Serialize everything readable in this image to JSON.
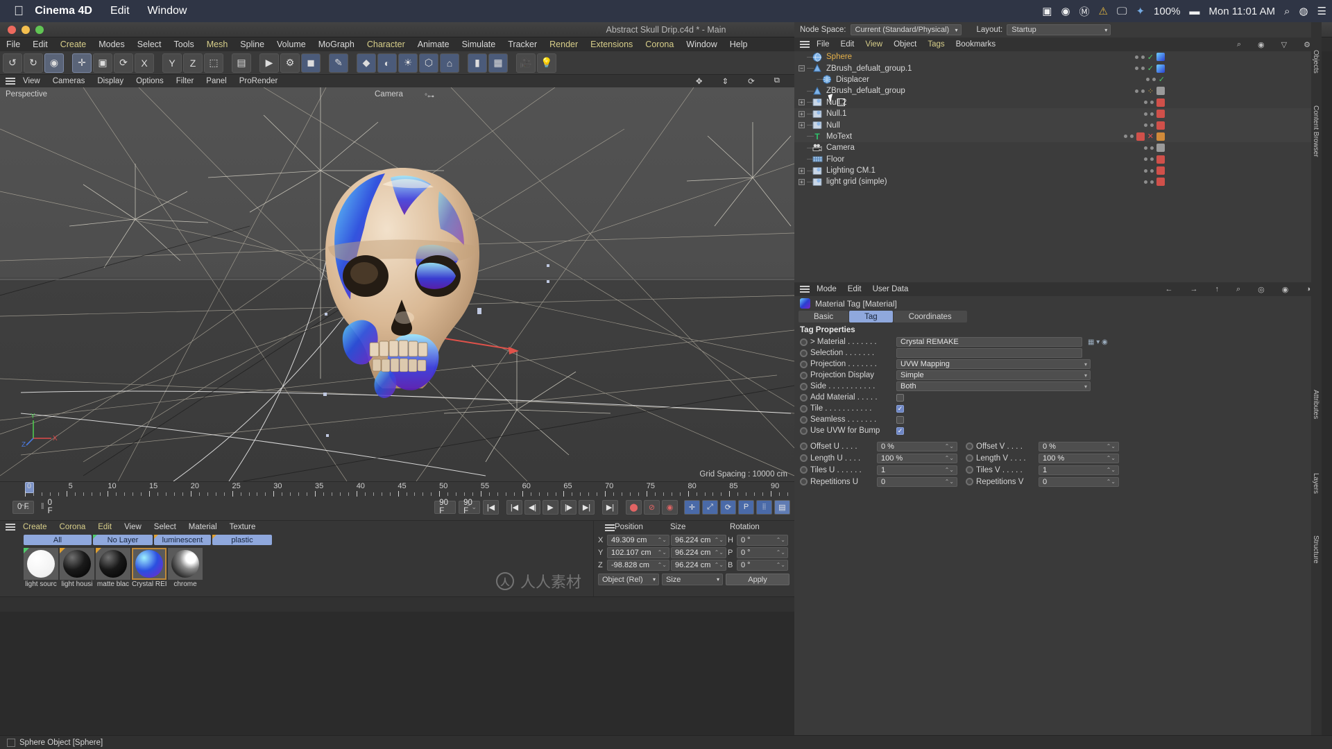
{
  "mac_menu": {
    "apple": "apple-logo",
    "items": [
      "Cinema 4D",
      "Edit",
      "Window"
    ],
    "status": {
      "battery": "100%",
      "time": "Mon 11:01 AM",
      "icons": [
        "screen-record-icon",
        "control-icon",
        "music-icon",
        "warning-icon",
        "display-icon",
        "bluetooth-icon",
        "battery-icon",
        "search-icon",
        "siri-icon",
        "control-center-icon"
      ]
    }
  },
  "window": {
    "title": "Abstract Skull Drip.c4d * - Main"
  },
  "app_menu": {
    "items": [
      {
        "label": "File",
        "accent": false
      },
      {
        "label": "Edit",
        "accent": false
      },
      {
        "label": "Create",
        "accent": true
      },
      {
        "label": "Modes",
        "accent": false
      },
      {
        "label": "Select",
        "accent": false
      },
      {
        "label": "Tools",
        "accent": false
      },
      {
        "label": "Mesh",
        "accent": true
      },
      {
        "label": "Spline",
        "accent": false
      },
      {
        "label": "Volume",
        "accent": false
      },
      {
        "label": "MoGraph",
        "accent": false
      },
      {
        "label": "Character",
        "accent": true
      },
      {
        "label": "Animate",
        "accent": false
      },
      {
        "label": "Simulate",
        "accent": false
      },
      {
        "label": "Tracker",
        "accent": false
      },
      {
        "label": "Render",
        "accent": true
      },
      {
        "label": "Extensions",
        "accent": true
      },
      {
        "label": "Corona",
        "accent": true
      },
      {
        "label": "Window",
        "accent": false
      },
      {
        "label": "Help",
        "accent": false
      }
    ]
  },
  "toolbar": {
    "buttons": [
      {
        "name": "undo-button",
        "glyph": "↺"
      },
      {
        "name": "redo-button",
        "glyph": "↻"
      },
      {
        "name": "live-selection-tool",
        "glyph": "◉",
        "state": "selected"
      },
      {
        "name": "move-tool",
        "glyph": "✛",
        "state": "selected"
      },
      {
        "name": "scale-tool",
        "glyph": "▣"
      },
      {
        "name": "rotate-tool",
        "glyph": "⟳"
      },
      {
        "name": "axis-lock-x",
        "glyph": "X"
      },
      {
        "name": "axis-lock-y",
        "glyph": "Y"
      },
      {
        "name": "axis-lock-z",
        "glyph": "Z"
      },
      {
        "name": "world-object-toggle",
        "glyph": "⬚"
      },
      {
        "name": "render-view-button",
        "glyph": "▤"
      },
      {
        "name": "render-region-button",
        "glyph": "▶"
      },
      {
        "name": "render-settings-button",
        "glyph": "⚙"
      },
      {
        "name": "cube-primitive-button",
        "glyph": "◼"
      },
      {
        "name": "spline-pen-button",
        "glyph": "✎"
      },
      {
        "name": "generator-button",
        "glyph": "◆"
      },
      {
        "name": "bend-deformer-button",
        "glyph": "◐"
      },
      {
        "name": "environment-button",
        "glyph": "☀"
      },
      {
        "name": "mograph-button",
        "glyph": "⬡"
      },
      {
        "name": "camera-button",
        "glyph": "⌂"
      },
      {
        "name": "light-button",
        "glyph": "▮"
      },
      {
        "name": "corona-render-button",
        "glyph": "▦"
      },
      {
        "name": "corona-camera-button",
        "glyph": "🎥"
      },
      {
        "name": "corona-light-button",
        "glyph": "💡"
      }
    ]
  },
  "viewport": {
    "menu": [
      "View",
      "Cameras",
      "Display",
      "Options",
      "Filter",
      "Panel",
      "ProRender"
    ],
    "perspective_label": "Perspective",
    "camera_label": "Camera",
    "grid_label": "Grid Spacing : 10000 cm",
    "axis_labels": {
      "x": "X",
      "y": "Y",
      "z": "Z"
    },
    "corner_icons": [
      "pan-icon",
      "dolly-icon",
      "rotate-icon",
      "maximize-icon"
    ]
  },
  "timeline": {
    "ticks": [
      0,
      5,
      10,
      15,
      20,
      25,
      30,
      35,
      40,
      45,
      50,
      55,
      60,
      65,
      70,
      75,
      80,
      85,
      90
    ],
    "current_frame": "0 F",
    "current_frame_2": "0 F",
    "start_frame": "0 F",
    "preview_min": "0 F",
    "preview_max": "90 F",
    "end_frame": "90 F",
    "right_frame": "0 F",
    "transport": [
      {
        "name": "goto-start-button",
        "glyph": "|◀"
      },
      {
        "name": "go-to-start-button",
        "glyph": "|◀"
      },
      {
        "name": "step-back-button",
        "glyph": "◀|"
      },
      {
        "name": "play-button",
        "glyph": "▶"
      },
      {
        "name": "step-forward-button",
        "glyph": "|▶"
      },
      {
        "name": "goto-end-button",
        "glyph": "▶|"
      },
      {
        "name": "next-key-button",
        "glyph": "▶|"
      }
    ],
    "record_buttons": [
      {
        "name": "record-active-objects-button",
        "glyph": "⬤"
      },
      {
        "name": "autokeying-button",
        "glyph": "⊘"
      },
      {
        "name": "keyframe-selection-button",
        "glyph": "◉"
      },
      {
        "name": "position-key-button",
        "glyph": "✛"
      },
      {
        "name": "scale-key-button",
        "glyph": "⤢"
      },
      {
        "name": "rotation-key-button",
        "glyph": "⟳"
      },
      {
        "name": "param-key-button",
        "glyph": "P"
      },
      {
        "name": "pla-key-button",
        "glyph": "⦙⦙"
      },
      {
        "name": "level-of-detail-button",
        "glyph": "▤"
      }
    ]
  },
  "material_manager": {
    "menu": [
      "Create",
      "Corona",
      "Edit",
      "View",
      "Select",
      "Material",
      "Texture"
    ],
    "layers": [
      "All",
      "No Layer",
      "luminescent",
      "plastic"
    ],
    "materials": [
      {
        "name": "light sourc",
        "color": "#ffffff",
        "tag": "green"
      },
      {
        "name": "light housi",
        "color": "#1a1a1a",
        "tag": "orange"
      },
      {
        "name": "matte blac",
        "color": "#181818",
        "tag": "orange"
      },
      {
        "name": "Crystal REI",
        "color": "#3a4fd6",
        "tag": "none",
        "selected": true
      },
      {
        "name": "chrome",
        "color": "#5a5a5a",
        "tag": "none"
      }
    ]
  },
  "coordinates": {
    "headers": [
      "Position",
      "Size",
      "Rotation"
    ],
    "rows": [
      {
        "axis": "X",
        "position": "49.309 cm",
        "size": "96.224 cm",
        "rot_axis": "H",
        "rotation": "0 °"
      },
      {
        "axis": "Y",
        "position": "102.107 cm",
        "size": "96.224 cm",
        "rot_axis": "P",
        "rotation": "0 °"
      },
      {
        "axis": "Z",
        "position": "-98.828 cm",
        "size": "96.224 cm",
        "rot_axis": "B",
        "rotation": "0 °"
      }
    ],
    "mode_select": "Object (Rel)",
    "size_select": "Size",
    "apply_label": "Apply"
  },
  "status_bar": {
    "text": "Sphere Object [Sphere]"
  },
  "node_space": {
    "label": "Node Space:",
    "value": "Current (Standard/Physical)",
    "layout_label": "Layout:",
    "layout_value": "Startup"
  },
  "object_manager": {
    "menu": [
      "File",
      "Edit",
      "View",
      "Object",
      "Tags",
      "Bookmarks"
    ],
    "right_icons": [
      "search-icon",
      "eye-icon",
      "filter-icon",
      "gear-icon"
    ],
    "items": [
      {
        "label": "Sphere",
        "icon": "sphere-icon",
        "indent": 0,
        "toggle": "none",
        "selected": true,
        "tags": [
          "check",
          "blue"
        ]
      },
      {
        "label": "ZBrush_defualt_group.1",
        "icon": "cone-icon",
        "indent": 0,
        "toggle": "minus",
        "selected": false,
        "tags": [
          "check",
          "blue"
        ]
      },
      {
        "label": "Displacer",
        "icon": "displacer-icon",
        "indent": 1,
        "toggle": "none",
        "selected": false,
        "tags": [
          "check"
        ]
      },
      {
        "label": "ZBrush_defualt_group",
        "icon": "cone-icon",
        "indent": 0,
        "toggle": "none",
        "selected": false,
        "tags": [
          "dots",
          "grey"
        ]
      },
      {
        "label": "Null.2",
        "icon": "null-icon",
        "indent": 0,
        "toggle": "plus",
        "selected": false,
        "tags": [
          "red"
        ]
      },
      {
        "label": "Null.1",
        "icon": "null-icon",
        "indent": 0,
        "toggle": "plus",
        "selected": false,
        "tags": [
          "red"
        ]
      },
      {
        "label": "Null",
        "icon": "null-icon",
        "indent": 0,
        "toggle": "plus",
        "selected": false,
        "tags": [
          "red"
        ]
      },
      {
        "label": "MoText",
        "icon": "motext-icon",
        "indent": 0,
        "toggle": "none",
        "selected": false,
        "tags": [
          "red",
          "x",
          "orange"
        ]
      },
      {
        "label": "Camera",
        "icon": "camera-icon",
        "indent": 0,
        "toggle": "none",
        "selected": false,
        "tags": [
          "grey"
        ]
      },
      {
        "label": "Floor",
        "icon": "floor-icon",
        "indent": 0,
        "toggle": "none",
        "selected": false,
        "tags": [
          "red"
        ]
      },
      {
        "label": "Lighting CM.1",
        "icon": "null-icon",
        "indent": 0,
        "toggle": "plus",
        "selected": false,
        "tags": [
          "red"
        ]
      },
      {
        "label": "light grid (simple)",
        "icon": "null-icon",
        "indent": 0,
        "toggle": "plus",
        "selected": false,
        "tags": [
          "red"
        ]
      }
    ]
  },
  "attributes": {
    "menu": [
      "Mode",
      "Edit",
      "User Data"
    ],
    "right_icons": [
      "back-arrow-icon",
      "forward-arrow-icon",
      "up-arrow-icon",
      "search-icon",
      "pin-icon",
      "lock-icon",
      "eye-icon"
    ],
    "title": "Material Tag [Material]",
    "tabs": [
      {
        "label": "Basic",
        "active": false
      },
      {
        "label": "Tag",
        "active": true
      },
      {
        "label": "Coordinates",
        "active": false
      }
    ],
    "section_title": "Tag Properties",
    "rows": [
      {
        "label": "> Material . . . . . . .",
        "type": "text",
        "value": "Crystal REMAKE",
        "name": "material-field"
      },
      {
        "label": "Selection . . . . . . .",
        "type": "text",
        "value": "",
        "name": "selection-field"
      },
      {
        "label": "Projection . . . . . . .",
        "type": "select",
        "value": "UVW Mapping",
        "name": "projection-select"
      },
      {
        "label": "Projection Display",
        "type": "select",
        "value": "Simple",
        "name": "projection-display-select"
      },
      {
        "label": "Side . . . . . . . . . . .",
        "type": "select",
        "value": "Both",
        "name": "side-select"
      },
      {
        "label": "Add Material . . . . .",
        "type": "check",
        "value": false,
        "name": "add-material-checkbox"
      },
      {
        "label": "Tile . . . . . . . . . . .",
        "type": "check",
        "value": true,
        "name": "tile-checkbox"
      },
      {
        "label": "Seamless . . . . . . .",
        "type": "check",
        "value": false,
        "name": "seamless-checkbox"
      },
      {
        "label": "Use UVW for Bump",
        "type": "check",
        "value": true,
        "name": "use-uvw-bump-checkbox"
      }
    ],
    "pairs": [
      {
        "l1": "Offset U . . . .",
        "v1": "0 %",
        "n1": "offset-u-field",
        "l2": "Offset V . . . .",
        "v2": "0 %",
        "n2": "offset-v-field"
      },
      {
        "l1": "Length U . . . .",
        "v1": "100 %",
        "n1": "length-u-field",
        "l2": "Length V . . . .",
        "v2": "100 %",
        "n2": "length-v-field"
      },
      {
        "l1": "Tiles U . . . . . .",
        "v1": "1",
        "n1": "tiles-u-field",
        "l2": "Tiles V . . . . .",
        "v2": "1",
        "n2": "tiles-v-field"
      },
      {
        "l1": "Repetitions U",
        "v1": "0",
        "n1": "repetitions-u-field",
        "l2": "Repetitions V",
        "v2": "0",
        "n2": "repetitions-v-field"
      }
    ]
  },
  "right_dock": {
    "labels": [
      "Objects",
      "Content Browser",
      "Attributes",
      "Layers",
      "Structure"
    ]
  },
  "colors": {
    "accent": "#8fa8dd",
    "menu_accent": "#d8cf8a",
    "selected_item": "#e5b14a"
  }
}
